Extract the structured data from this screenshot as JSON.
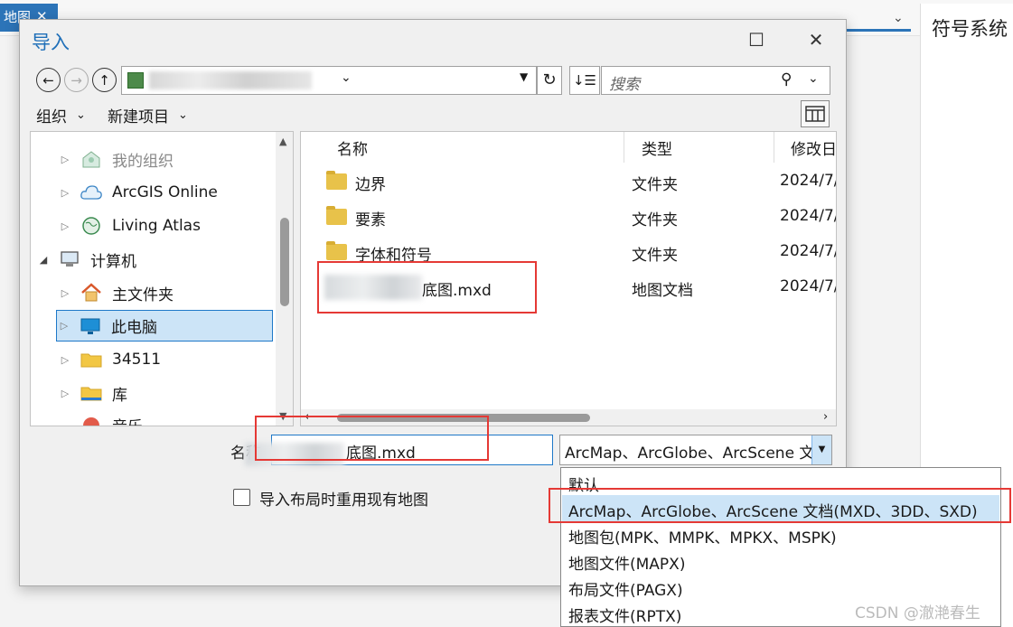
{
  "background": {
    "map_tab_label": "地图",
    "right_panel_title": "符号系统"
  },
  "dialog": {
    "title": "导入",
    "toolbar": {
      "organize": "组织",
      "new_item": "新建项目"
    },
    "search_placeholder": "搜索",
    "tree": [
      {
        "label": "我的组织",
        "icon": "organization-icon",
        "indent": 1,
        "faded": true
      },
      {
        "label": "ArcGIS Online",
        "icon": "cloud-icon",
        "indent": 1
      },
      {
        "label": "Living Atlas",
        "icon": "globe-icon",
        "indent": 1
      },
      {
        "label": "计算机",
        "icon": "computer-icon",
        "indent": 0,
        "expanded": true
      },
      {
        "label": "主文件夹",
        "icon": "home-icon",
        "indent": 1
      },
      {
        "label": "此电脑",
        "icon": "monitor-icon",
        "indent": 1,
        "selected": true
      },
      {
        "label": "34511",
        "icon": "folder-icon",
        "indent": 1
      },
      {
        "label": "库",
        "icon": "library-icon",
        "indent": 1
      },
      {
        "label": "音乐",
        "icon": "music-icon",
        "indent": 1
      }
    ],
    "columns": {
      "name": "名称",
      "type": "类型",
      "modified": "修改日"
    },
    "files": [
      {
        "name": "边界",
        "type": "文件夹",
        "modified": "2024/7/",
        "icon": "folder-icon"
      },
      {
        "name": "要素",
        "type": "文件夹",
        "modified": "2024/7/",
        "icon": "folder-icon"
      },
      {
        "name": "字体和符号",
        "type": "文件夹",
        "modified": "2024/7/",
        "icon": "folder-icon"
      },
      {
        "name": "底图.mxd",
        "type": "地图文档",
        "modified": "2024/7/",
        "icon": "map-document-icon"
      }
    ],
    "filename_label": "名称",
    "filename_value": "底图.mxd",
    "filetype_value": "ArcMap、ArcGlobe、ArcScene 文档(MXD、3DD、SXD)",
    "reuse_checkbox_label": "导入布局时重用现有地图",
    "filetype_options": [
      {
        "label": "默认"
      },
      {
        "label": "ArcMap、ArcGlobe、ArcScene 文档(MXD、3DD、SXD)",
        "selected": true
      },
      {
        "label": "地图包(MPK、MMPK、MPKX、MSPK)"
      },
      {
        "label": "地图文件(MAPX)"
      },
      {
        "label": "布局文件(PAGX)"
      },
      {
        "label": "报表文件(RPTX)"
      }
    ]
  },
  "watermark": "CSDN @澈滟春生",
  "colors": {
    "accent": "#1f6fb8",
    "selection": "#cce4f7",
    "highlight_box": "#e53935"
  }
}
